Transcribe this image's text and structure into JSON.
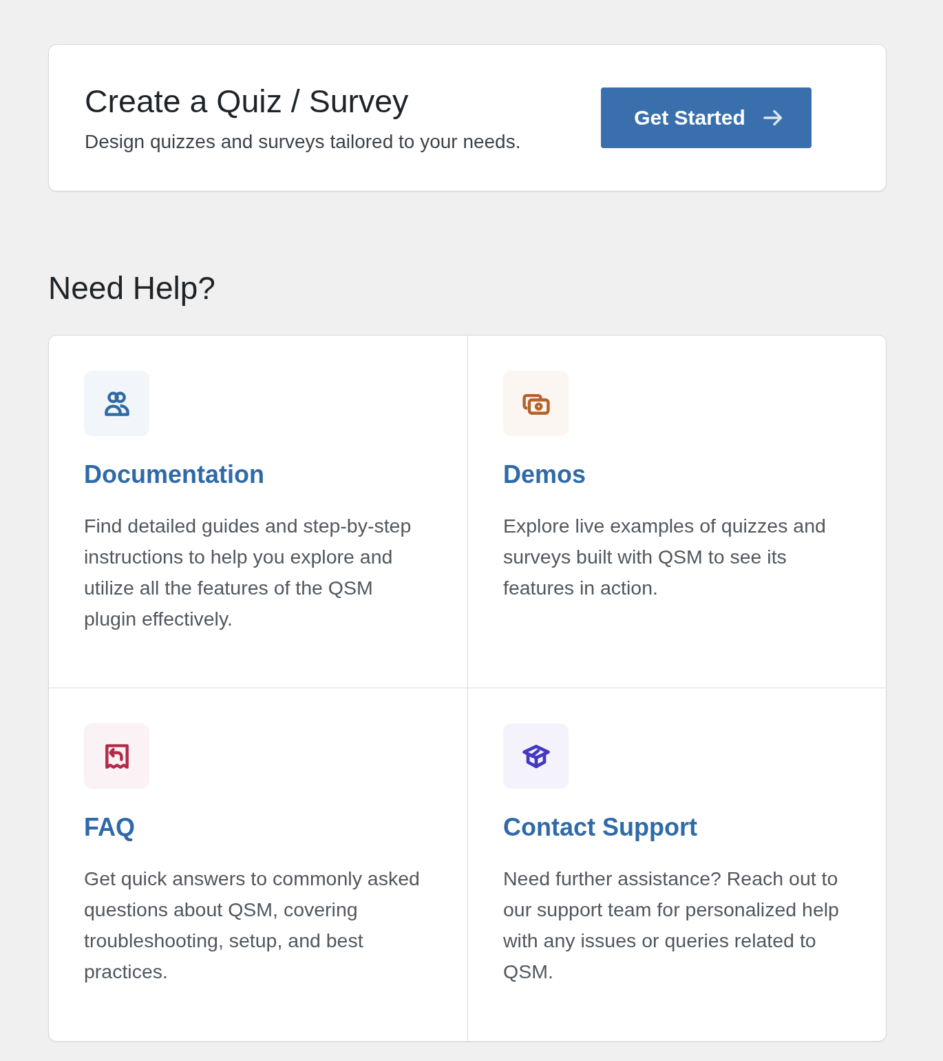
{
  "create_card": {
    "title": "Create a Quiz / Survey",
    "description": "Design quizzes and surveys tailored to your needs.",
    "button": {
      "label": "Get Started"
    }
  },
  "help": {
    "heading": "Need Help?",
    "items": [
      {
        "kind": "people",
        "color": "#2e6aa5",
        "title": "Documentation",
        "description": "Find detailed guides and step-by-step instructions to help you explore and utilize all the features of the QSM plugin effectively."
      },
      {
        "kind": "media",
        "color": "#b4622a",
        "title": "Demos",
        "description": "Explore live examples of quizzes and surveys built with QSM to see its features in action."
      },
      {
        "kind": "receipt",
        "color": "#b3294a",
        "title": "FAQ",
        "description": "Get quick answers to commonly asked questions about QSM, covering troubleshooting, setup, and best practices."
      },
      {
        "kind": "graduation",
        "color": "#4338c4",
        "title": "Contact Support",
        "description": "Need further assistance? Reach out to our support team for personalized help with any issues or queries related to QSM."
      }
    ]
  }
}
